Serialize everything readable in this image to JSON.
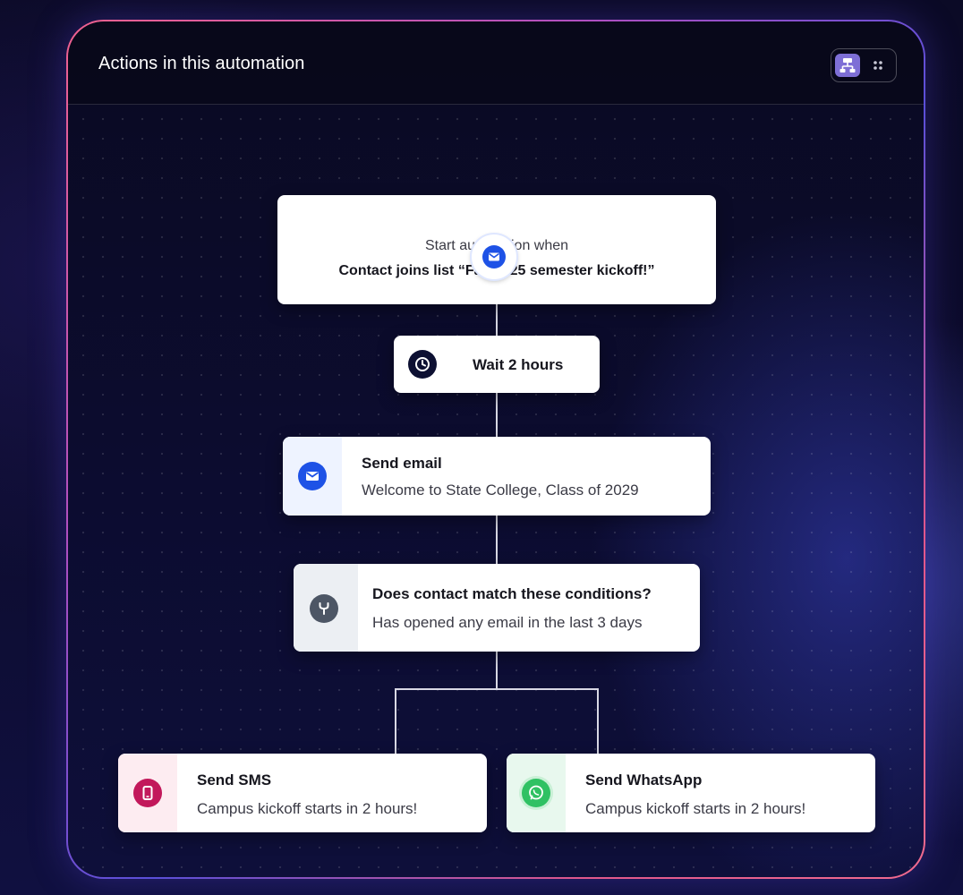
{
  "panel": {
    "title": "Actions in this automation",
    "view_toggle": [
      "flow-view-icon",
      "grid-view-icon"
    ]
  },
  "trigger": {
    "icon": "email-icon",
    "label": "Start automation when",
    "condition": "Contact joins list “Fall 2025 semester kickoff!”"
  },
  "wait": {
    "icon": "clock-icon",
    "label": "Wait 2 hours"
  },
  "send_email": {
    "icon": "email-icon",
    "title": "Send email",
    "subtitle": "Welcome to State College, Class of 2029"
  },
  "condition": {
    "icon": "branch-icon",
    "title": "Does contact match these conditions?",
    "subtitle": "Has opened any email in the last 3 days"
  },
  "send_sms": {
    "icon": "phone-icon",
    "title": "Send SMS",
    "subtitle": "Campus kickoff starts in 2 hours!"
  },
  "send_whatsapp": {
    "icon": "whatsapp-icon",
    "title": "Send WhatsApp",
    "subtitle": "Campus kickoff starts in 2 hours!"
  },
  "colors": {
    "email_blue": "#1e52e6",
    "sms_magenta": "#c2185b",
    "whatsapp_green": "#2fc163",
    "toggle_active": "#7e6fd6"
  }
}
